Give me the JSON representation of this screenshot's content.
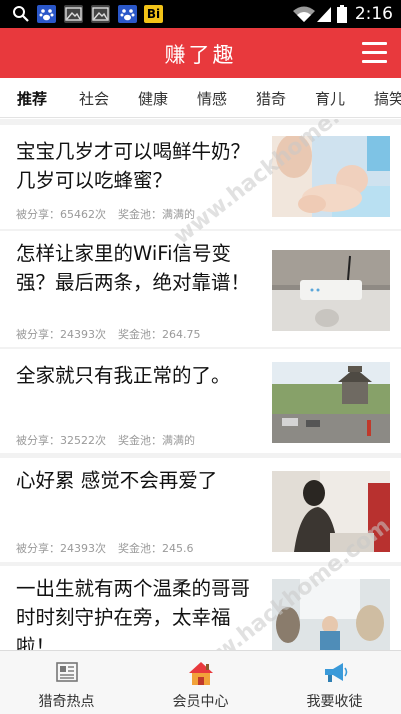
{
  "status_bar": {
    "time": "2:16",
    "notification_icons": [
      "search-icon",
      "baidu-paw-icon",
      "image-icon",
      "image-icon",
      "baidu-paw-icon",
      "bi-app-icon"
    ],
    "bi_text": "Bi"
  },
  "header": {
    "title": "赚了趣",
    "menu_icon": "hamburger-menu-icon",
    "background": "#e8393d"
  },
  "tabs": [
    {
      "label": "推荐",
      "active": true
    },
    {
      "label": "社会",
      "active": false
    },
    {
      "label": "健康",
      "active": false
    },
    {
      "label": "情感",
      "active": false
    },
    {
      "label": "猎奇",
      "active": false
    },
    {
      "label": "育儿",
      "active": false
    },
    {
      "label": "搞笑",
      "active": false
    }
  ],
  "feed": [
    {
      "title": "宝宝几岁才可以喝鲜牛奶？几岁可以吃蜂蜜？",
      "shared": "被分享：65462次",
      "pool": "奖金池：满满的",
      "thumb": "baby-photo"
    },
    {
      "title": "怎样让家里的WiFi信号变强？最后两条，绝对靠谱！",
      "shared": "被分享：24393次",
      "pool": "奖金池：264.75",
      "thumb": "wifi-router-photo"
    },
    {
      "title": "全家就只有我正常的了。",
      "shared": "被分享：32522次",
      "pool": "奖金池：满满的",
      "thumb": "pagoda-street-photo"
    },
    {
      "title": "心好累 感觉不会再爱了",
      "shared": "被分享：24393次",
      "pool": "奖金池：245.6",
      "thumb": "woman-sitting-photo"
    },
    {
      "title": "一出生就有两个温柔的哥哥时时刻守护在旁，太幸福啦！",
      "shared": "",
      "pool": "",
      "thumb": "child-with-dogs-photo"
    }
  ],
  "bottom_nav": [
    {
      "label": "猎奇热点",
      "icon": "newspaper-icon"
    },
    {
      "label": "会员中心",
      "icon": "house-icon"
    },
    {
      "label": "我要收徒",
      "icon": "megaphone-icon"
    }
  ],
  "watermark": "www.hackhome.com"
}
